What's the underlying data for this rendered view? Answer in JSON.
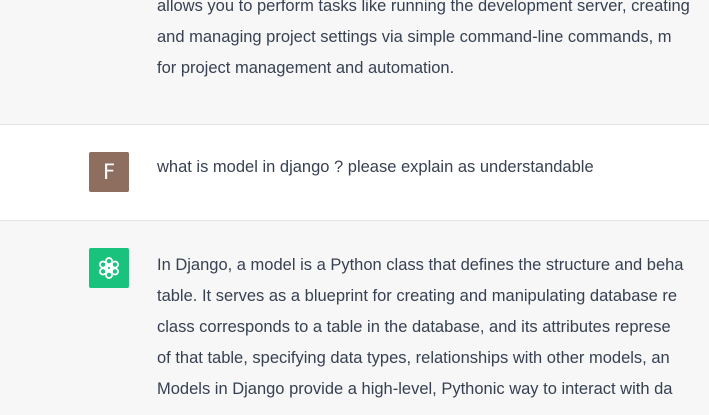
{
  "conversation": {
    "prev_response": {
      "lines": [
        "allows you to perform tasks like running the development server, creating",
        "and managing project settings via simple command-line commands, m",
        "for project management and automation."
      ]
    },
    "user_message": {
      "avatar_letter": "F",
      "text": "what is model in django ? please explain as understandable"
    },
    "assistant_response": {
      "lines": [
        "In Django, a model is a Python class that defines the structure and beha",
        "table. It serves as a blueprint for creating and manipulating database re",
        "class corresponds to a table in the database, and its attributes represe",
        "of that table, specifying data types, relationships with other models, an",
        "Models in Django provide a high-level, Pythonic way to interact with da"
      ]
    }
  },
  "colors": {
    "assistant_bg": "#f7f7f8",
    "user_avatar": "#8e6e5f",
    "bot_avatar": "#19c37d",
    "text": "#374151"
  }
}
